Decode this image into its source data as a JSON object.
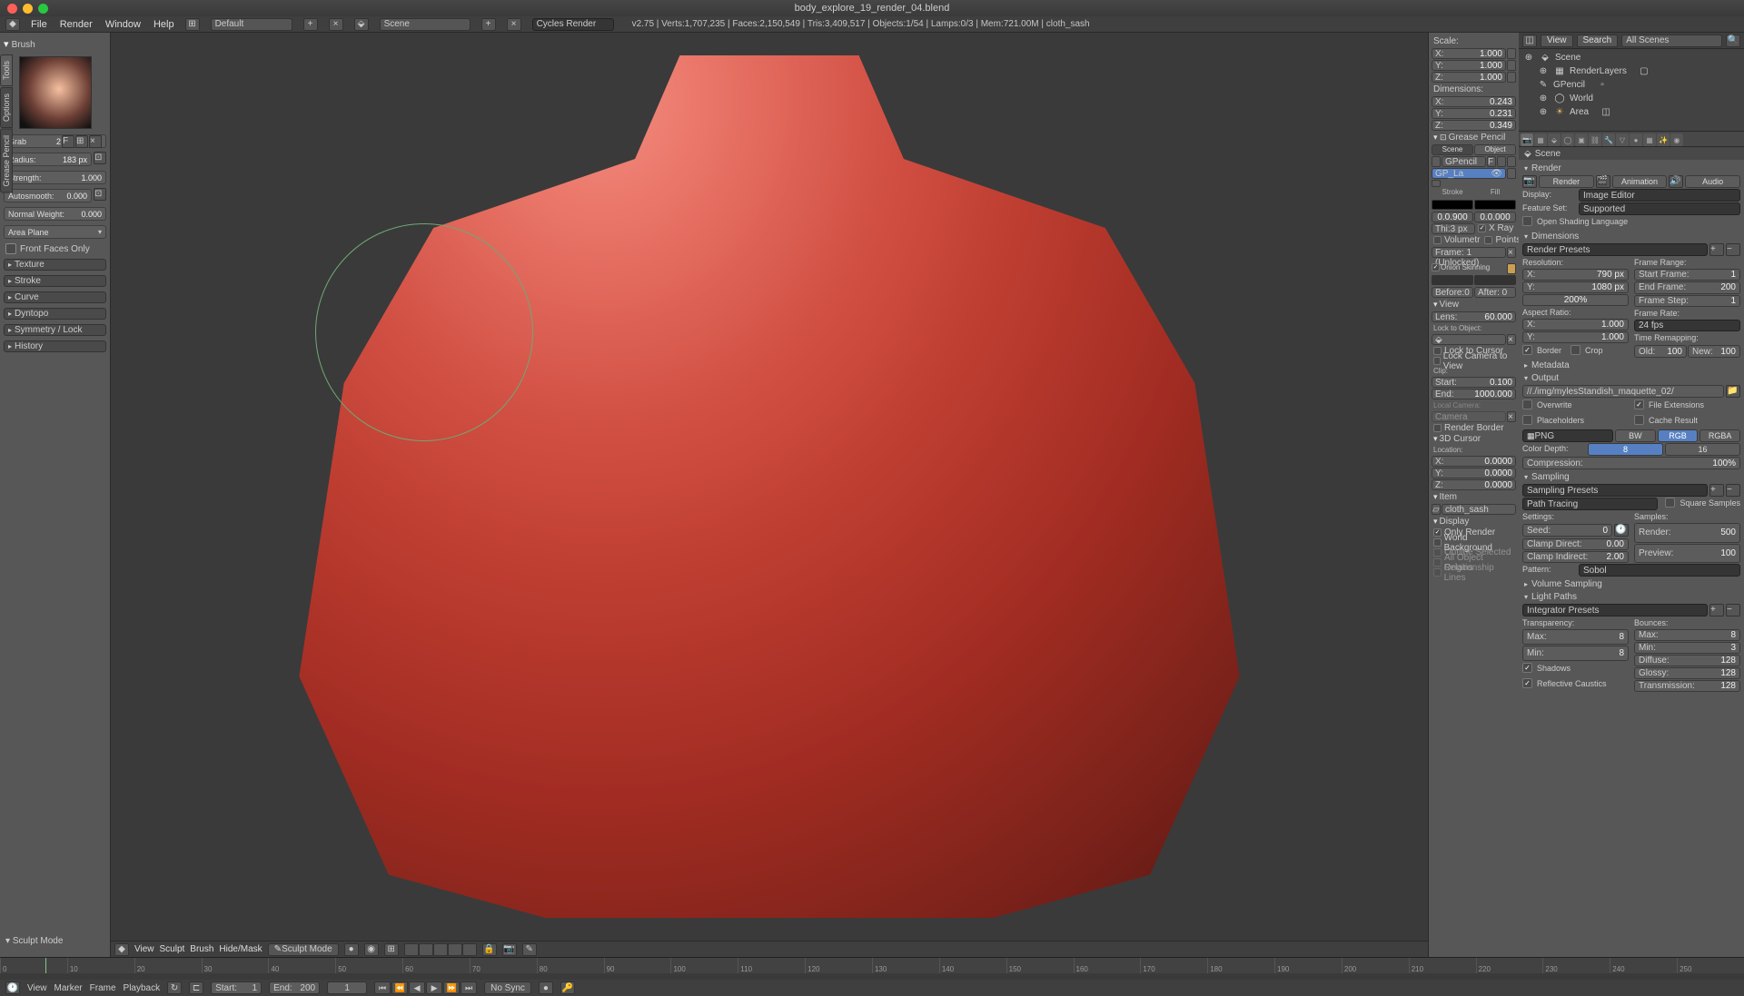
{
  "file": {
    "name": "body_explore_19_render_04.blend"
  },
  "menu": {
    "items": [
      "File",
      "Render",
      "Window",
      "Help"
    ]
  },
  "header": {
    "layout": "Default",
    "scene": "Scene",
    "engine": "Cycles Render",
    "stats": "v2.75 | Verts:1,707,235 | Faces:2,150,549 | Tris:3,409,517 | Objects:1/54 | Lamps:0/3 | Mem:721.00M | cloth_sash"
  },
  "left_tabs": [
    "Tools",
    "Options",
    "Grease Pencil"
  ],
  "brush": {
    "title": "Brush",
    "name": "Grab",
    "count": "2",
    "radius_lbl": "Radius:",
    "radius": "183 px",
    "strength_lbl": "Strength:",
    "strength": "1.000",
    "autosmooth_lbl": "Autosmooth:",
    "autosmooth": "0.000",
    "normal_weight_lbl": "Normal Weight:",
    "normal_weight": "0.000",
    "area_plane": "Area Plane",
    "front_faces": "Front Faces Only",
    "sections": [
      "Texture",
      "Stroke",
      "Curve",
      "Dyntopo",
      "Symmetry / Lock",
      "History"
    ],
    "mode_label": "Sculpt Mode"
  },
  "n": {
    "scale_h": "Scale:",
    "scale_x": "X:",
    "scale_xv": "1.000",
    "scale_y": "Y:",
    "scale_yv": "1.000",
    "scale_z": "Z:",
    "scale_zv": "1.000",
    "dim_h": "Dimensions:",
    "dim_x": "X:",
    "dim_xv": "0.243",
    "dim_y": "Y:",
    "dim_yv": "0.231",
    "dim_z": "Z:",
    "dim_zv": "0.349",
    "gp_h": "Grease Pencil",
    "gp_scene": "Scene",
    "gp_object": "Object",
    "gp_id": "GPencil",
    "gp_layer": "GP_La",
    "stroke_lbl": "Stroke",
    "fill_lbl": "Fill",
    "stroke_thi_lbl": "Thi:3 px",
    "stroke_thi": "0.0.900",
    "fill_alpha": "0.0.000",
    "xray": "X Ray",
    "volumetric": "Volumetr",
    "points": "Points",
    "frame_info": "Frame: 1 (Unlocked)",
    "onion": "Onion Skinning",
    "before": "Before:0",
    "after": "After: 0",
    "view_h": "View",
    "lens_lbl": "Lens:",
    "lens": "60.000",
    "lock_obj": "Lock to Object:",
    "lock_cursor": "Lock to Cursor",
    "lock_cam": "Lock Camera to View",
    "clip_h": "Clip:",
    "clip_start_lbl": "Start:",
    "clip_start": "0.100",
    "clip_end_lbl": "End:",
    "clip_end": "1000.000",
    "local_cam_h": "Local Camera:",
    "camera": "Camera",
    "render_border": "Render Border",
    "cursor_h": "3D Cursor",
    "loc_h": "Location:",
    "loc_x": "X:",
    "loc_xv": "0.0000",
    "loc_y": "Y:",
    "loc_yv": "0.0000",
    "loc_z": "Z:",
    "loc_zv": "0.0000",
    "item_h": "Item",
    "item_name": "cloth_sash",
    "display_h": "Display",
    "only_render": "Only Render",
    "world_bg": "World Background",
    "outline_sel": "Outline Selected",
    "all_origins": "All Object Origins",
    "rel_lines": "Relationship Lines"
  },
  "outliner": {
    "view_btn": "View",
    "search_btn": "Search",
    "combo": "All Scenes",
    "items": [
      {
        "name": "Scene",
        "icon": "▹",
        "indent": 0
      },
      {
        "name": "RenderLayers",
        "icon": "▹",
        "indent": 1
      },
      {
        "name": "GPencil",
        "icon": "✎",
        "indent": 1
      },
      {
        "name": "World",
        "icon": "▹",
        "indent": 1
      },
      {
        "name": "Area",
        "icon": "☀",
        "indent": 1
      }
    ]
  },
  "props": {
    "breadcrumb": "Scene",
    "render_h": "Render",
    "tab_render": "Render",
    "tab_anim": "Animation",
    "tab_audio": "Audio",
    "display_lbl": "Display:",
    "display_v": "Image Editor",
    "featureset_lbl": "Feature Set:",
    "featureset_v": "Supported",
    "osl": "Open Shading Language",
    "dimensions_h": "Dimensions",
    "render_presets": "Render Presets",
    "resolution_h": "Resolution:",
    "frame_range_h": "Frame Range:",
    "res_x_lbl": "X:",
    "res_x": "790 px",
    "res_y_lbl": "Y:",
    "res_y": "1080 px",
    "res_pct": "200%",
    "start_frame_lbl": "Start Frame:",
    "start_frame": "1",
    "end_frame_lbl": "End Frame:",
    "end_frame": "200",
    "frame_step_lbl": "Frame Step:",
    "frame_step": "1",
    "aspect_h": "Aspect Ratio:",
    "framerate_h": "Frame Rate:",
    "asp_x_lbl": "X:",
    "asp_x": "1.000",
    "framerate_v": "24 fps",
    "asp_y_lbl": "Y:",
    "asp_y": "1.000",
    "time_remap_h": "Time Remapping:",
    "old_lbl": "Old:",
    "old_v": "100",
    "new_lbl": "New:",
    "new_v": "100",
    "border": "Border",
    "crop": "Crop",
    "metadata_h": "Metadata",
    "output_h": "Output",
    "output_path": "//./img/mylesStandish_maquette_02/",
    "overwrite": "Overwrite",
    "file_ext": "File Extensions",
    "placeholders": "Placeholders",
    "cache_result": "Cache Result",
    "format": "PNG",
    "bw": "BW",
    "rgb": "RGB",
    "rgba": "RGBA",
    "color_depth_lbl": "Color Depth:",
    "cd_8": "8",
    "cd_16": "16",
    "compression_lbl": "Compression:",
    "compression": "100%",
    "sampling_h": "Sampling",
    "sampling_presets": "Sampling Presets",
    "sampling_method": "Path Tracing",
    "square_samples": "Square Samples",
    "settings_lbl": "Settings:",
    "samples_lbl": "Samples:",
    "seed_lbl": "Seed:",
    "seed": "0",
    "render_s_lbl": "Render:",
    "render_s": "500",
    "clamp_direct_lbl": "Clamp Direct:",
    "clamp_direct": "0.00",
    "preview_s_lbl": "Preview:",
    "preview_s": "100",
    "clamp_indirect_lbl": "Clamp Indirect:",
    "clamp_indirect": "2.00",
    "pattern_lbl": "Pattern:",
    "pattern_v": "Sobol",
    "vol_sampling_h": "Volume Sampling",
    "light_paths_h": "Light Paths",
    "integrator_presets": "Integrator Presets",
    "transparency_lbl": "Transparency:",
    "bounces_lbl": "Bounces:",
    "max_lbl": "Max:",
    "t_max": "8",
    "b_max": "8",
    "min_lbl": "Min:",
    "t_min": "8",
    "b_min": "3",
    "shadows": "Shadows",
    "diffuse_lbl": "Diffuse:",
    "diffuse": "128",
    "ref_caustics": "Reflective Caustics",
    "glossy_lbl": "Glossy:",
    "glossy": "128",
    "trans_lbl": "Transmission:",
    "trans": "128"
  },
  "vp_footer": {
    "view": "View",
    "sculpt": "Sculpt",
    "brush": "Brush",
    "hidemask": "Hide/Mask",
    "mode": "Sculpt Mode"
  },
  "timeline": {
    "ticks": [
      "0",
      "10",
      "20",
      "30",
      "40",
      "50",
      "60",
      "70",
      "80",
      "90",
      "100",
      "110",
      "120",
      "130",
      "140",
      "150",
      "160",
      "170",
      "180",
      "190",
      "200",
      "210",
      "220",
      "230",
      "240",
      "250"
    ],
    "view": "View",
    "marker": "Marker",
    "frame": "Frame",
    "playback": "Playback",
    "start_lbl": "Start:",
    "start": "1",
    "end_lbl": "End:",
    "end": "200",
    "current": "1",
    "sync": "No Sync"
  }
}
